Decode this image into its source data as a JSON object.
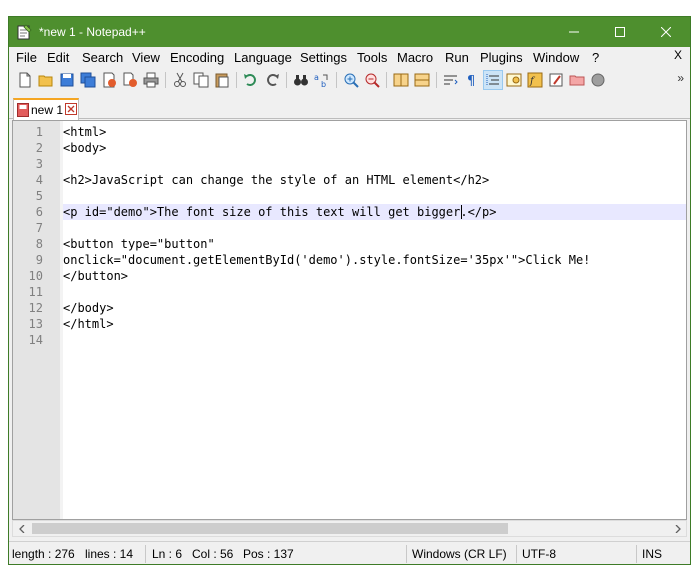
{
  "window": {
    "title": "*new 1 - Notepad++"
  },
  "menu": [
    "File",
    "Edit",
    "Search",
    "View",
    "Encoding",
    "Language",
    "Settings",
    "Tools",
    "Macro",
    "Run",
    "Plugins",
    "Window",
    "?"
  ],
  "menu_overflow": "X",
  "toolbar": {
    "buttons": [
      "new-file",
      "open-file",
      "save",
      "save-all",
      "close",
      "close-all",
      "print",
      "cut",
      "copy",
      "paste",
      "undo",
      "redo",
      "find",
      "replace",
      "zoom-in",
      "zoom-out",
      "sync-vertical",
      "sync-horizontal",
      "word-wrap",
      "show-all-characters",
      "indent-guide",
      "document-map",
      "function-list",
      "folder-workspace",
      "monitoring",
      "record-macro"
    ],
    "overflow": "»"
  },
  "tab": {
    "label": "new 1"
  },
  "editor": {
    "lines": [
      {
        "n": "1",
        "text": "<html>"
      },
      {
        "n": "2",
        "text": "<body>"
      },
      {
        "n": "3",
        "text": ""
      },
      {
        "n": "4",
        "text": "<h2>JavaScript can change the style of an HTML element</h2>"
      },
      {
        "n": "5",
        "text": ""
      },
      {
        "n": "6",
        "text": "<p id=\"demo\">The font size of this text will get bigger.</p>"
      },
      {
        "n": "7",
        "text": ""
      },
      {
        "n": "8",
        "text": "<button type=\"button\""
      },
      {
        "n": "9",
        "text": "onclick=\"document.getElementById('demo').style.fontSize='35px'\">Click Me!"
      },
      {
        "n": "10",
        "text": "</button>"
      },
      {
        "n": "11",
        "text": ""
      },
      {
        "n": "12",
        "text": "</body>"
      },
      {
        "n": "13",
        "text": "</html>"
      },
      {
        "n": "14",
        "text": ""
      }
    ],
    "current_line": 6
  },
  "status": {
    "length": "length : 276",
    "lines": "lines : 14",
    "ln": "Ln : 6",
    "col": "Col : 56",
    "pos": "Pos : 137",
    "eol": "Windows (CR LF)",
    "encoding": "UTF-8",
    "mode": "INS"
  },
  "colors": {
    "titlebar": "#4e8f2e",
    "current_line": "#e8e8ff",
    "gutter": "#e4e4e4",
    "tab_accent": "#f5a623"
  }
}
